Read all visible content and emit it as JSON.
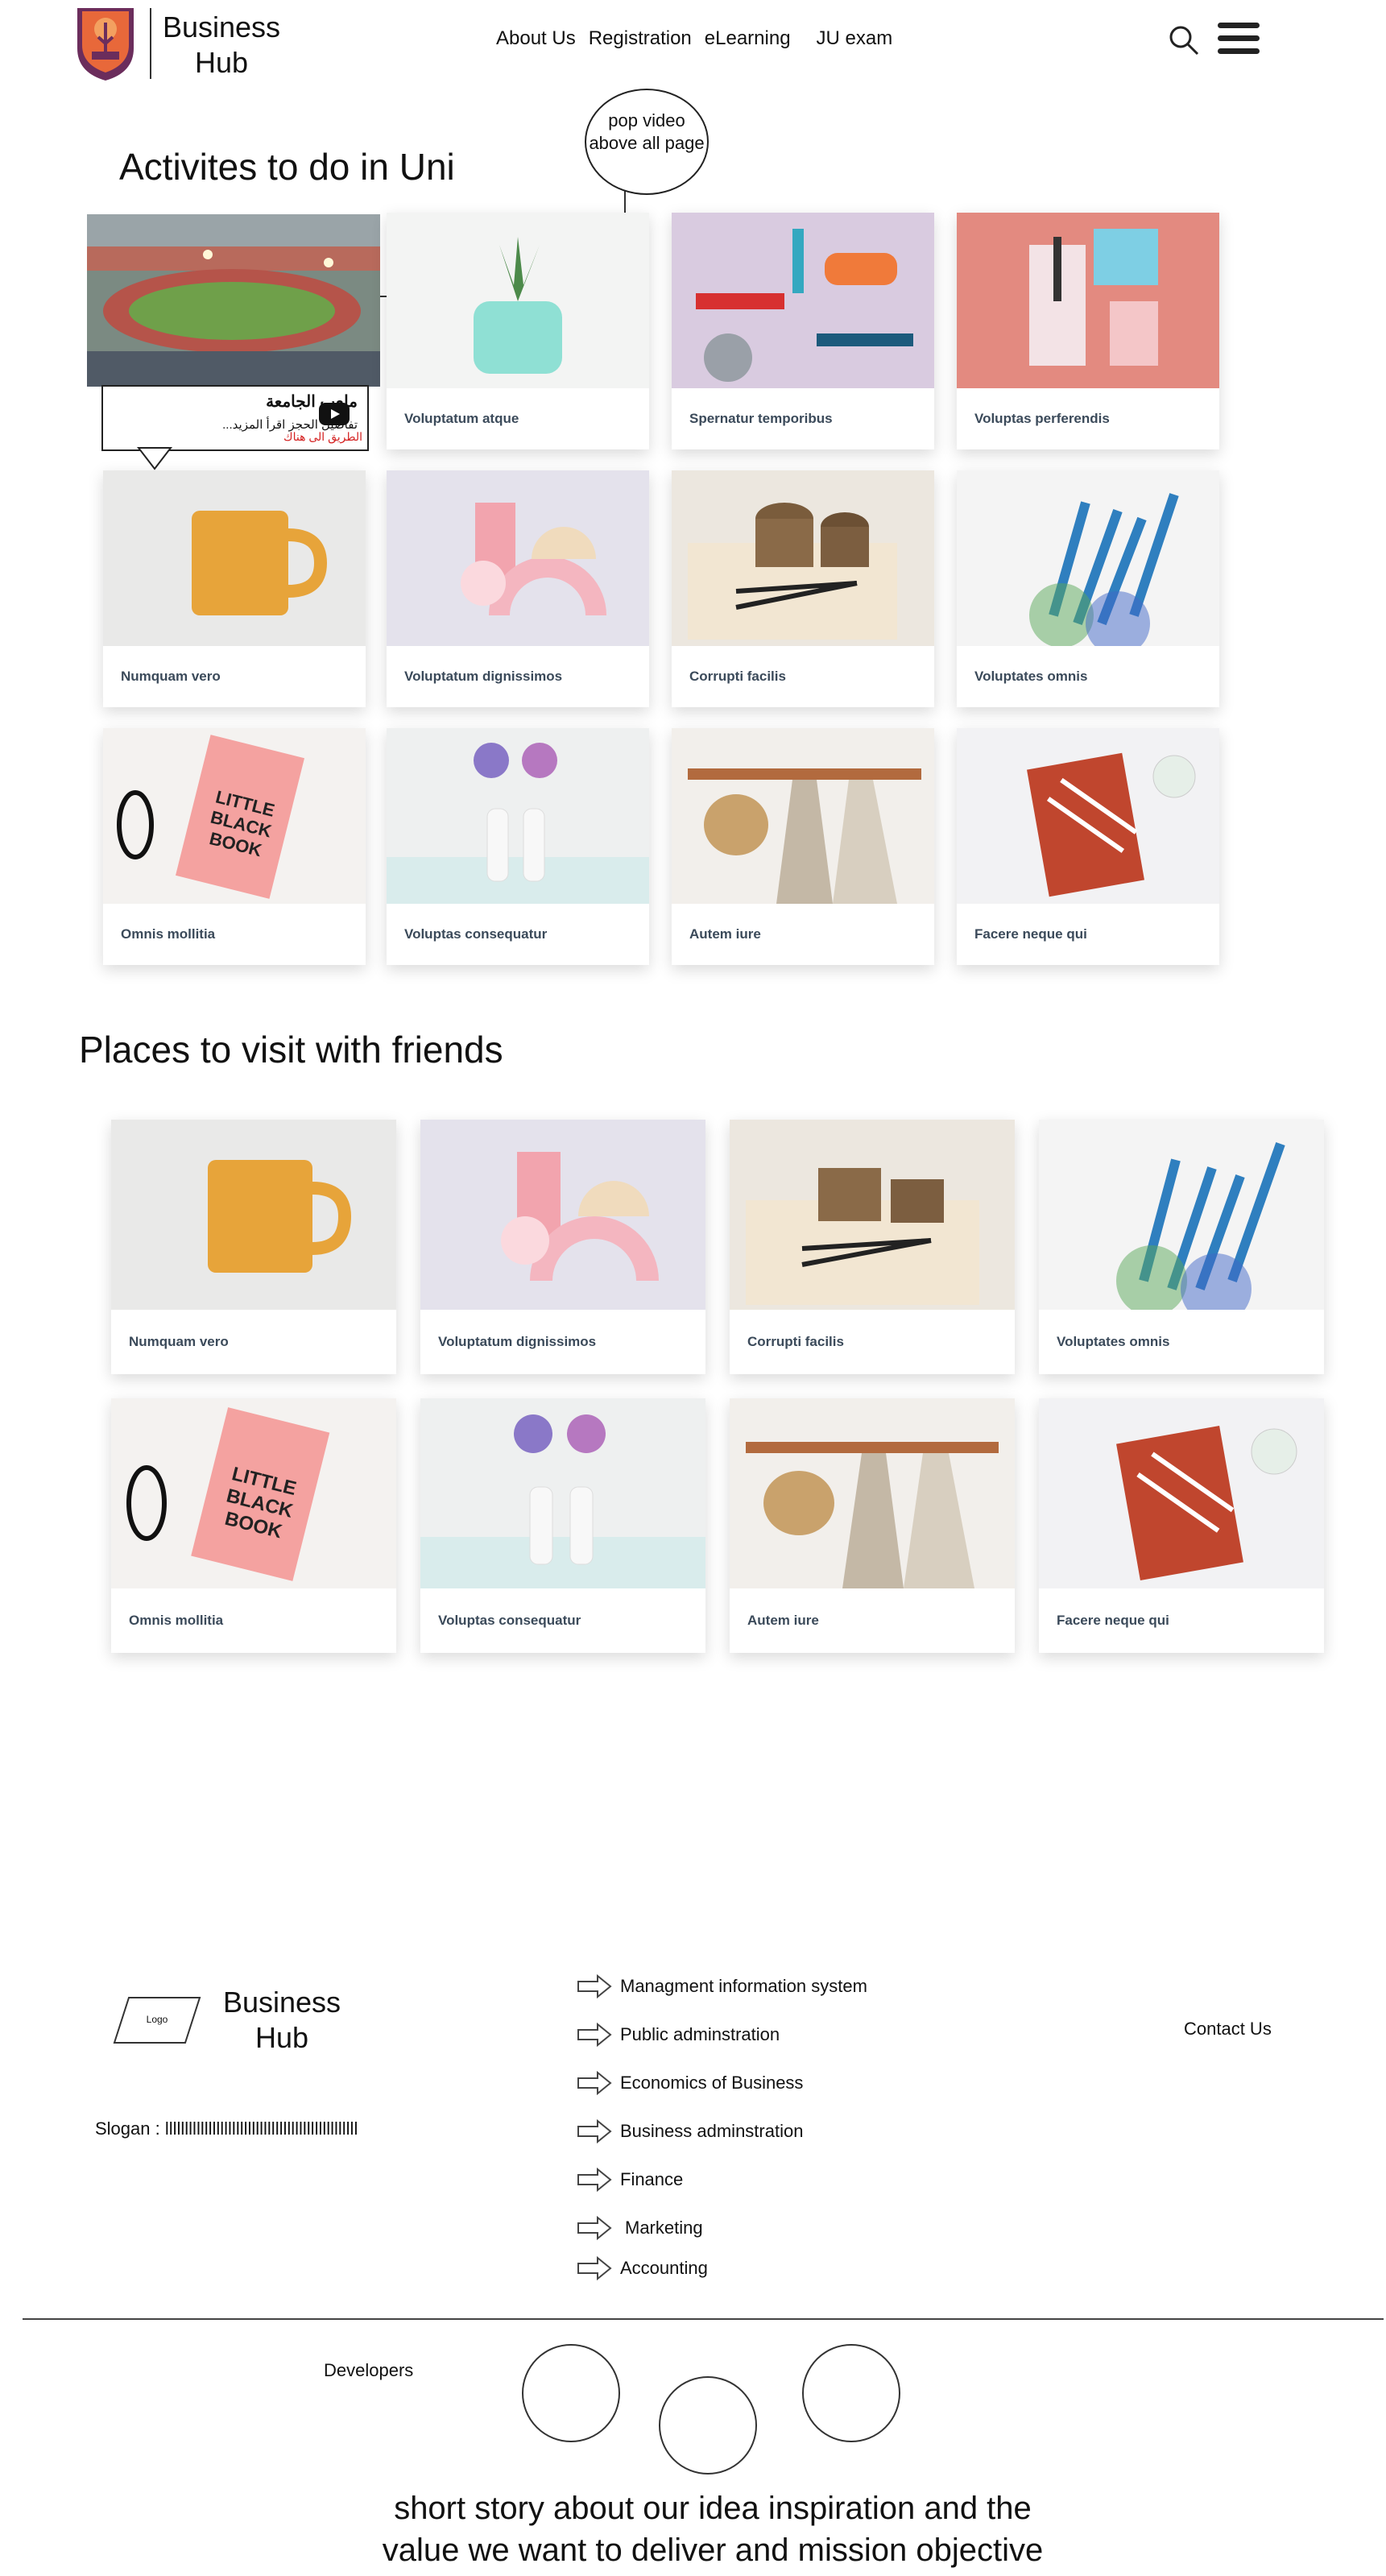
{
  "header": {
    "brand_line1": "Business",
    "brand_line2": "Hub",
    "nav": [
      "About Us",
      "Registration",
      "eLearning",
      "JU exam"
    ]
  },
  "activities": {
    "title": "Activites to do in Uni",
    "stadium": {
      "title": "ملعب الجامعة",
      "description": "تفاصيل الحجز اقرأ المزيد...",
      "link": "الطريق الى هناك"
    },
    "popup_note": "pop video above all page",
    "cards": [
      "Voluptatum atque",
      "Spernatur temporibus",
      "Voluptas perferendis",
      "Numquam vero",
      "Voluptatum dignissimos",
      "Corrupti facilis",
      "Voluptates omnis",
      "Omnis mollitia",
      "Voluptas consequatur",
      "Autem iure",
      "Facere neque qui"
    ]
  },
  "places": {
    "title": "Places to visit with friends",
    "cards": [
      "Numquam vero",
      "Voluptatum dignissimos",
      "Corrupti facilis",
      "Voluptates omnis",
      "Omnis mollitia",
      "Voluptas consequatur",
      "Autem iure",
      "Facere neque qui"
    ]
  },
  "footer": {
    "logo_text": "Logo",
    "brand_line1": "Business",
    "brand_line2": "Hub",
    "slogan": "Slogan  : lllllllllllllllllllllllllllllllllllllllllllllllll",
    "links": [
      "Managment information system",
      "Public adminstration",
      "Economics of Business",
      "Business adminstration",
      "Finance",
      "Marketing",
      "Accounting"
    ],
    "contact": "Contact Us",
    "developers": "Developers",
    "story_line1": "short story about our idea inspiration and the",
    "story_line2": "value we want to deliver and mission objective"
  }
}
